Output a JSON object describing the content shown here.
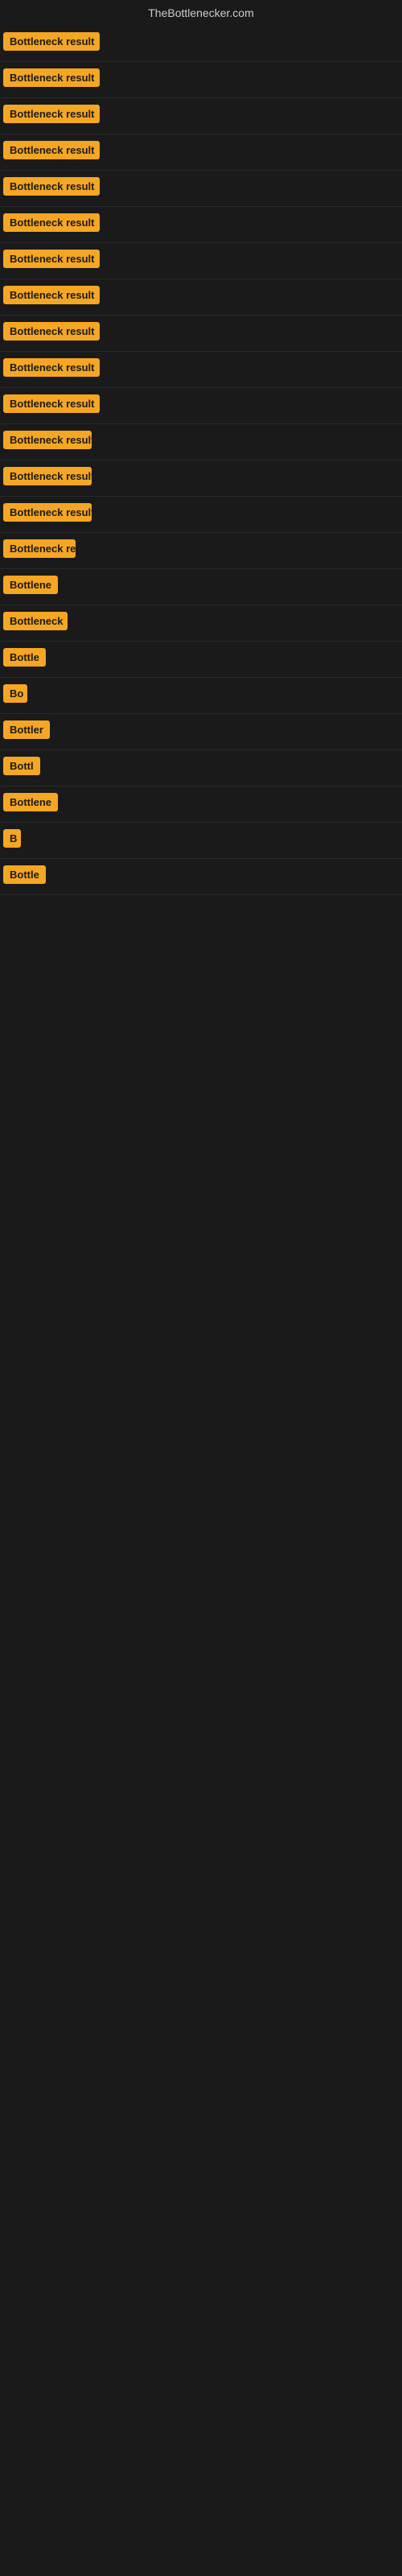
{
  "site": {
    "title": "TheBottlenecker.com"
  },
  "results": [
    {
      "id": 1,
      "label": "Bottleneck result",
      "width": 120
    },
    {
      "id": 2,
      "label": "Bottleneck result",
      "width": 120
    },
    {
      "id": 3,
      "label": "Bottleneck result",
      "width": 120
    },
    {
      "id": 4,
      "label": "Bottleneck result",
      "width": 120
    },
    {
      "id": 5,
      "label": "Bottleneck result",
      "width": 120
    },
    {
      "id": 6,
      "label": "Bottleneck result",
      "width": 120
    },
    {
      "id": 7,
      "label": "Bottleneck result",
      "width": 120
    },
    {
      "id": 8,
      "label": "Bottleneck result",
      "width": 120
    },
    {
      "id": 9,
      "label": "Bottleneck result",
      "width": 120
    },
    {
      "id": 10,
      "label": "Bottleneck result",
      "width": 120
    },
    {
      "id": 11,
      "label": "Bottleneck result",
      "width": 120
    },
    {
      "id": 12,
      "label": "Bottleneck result",
      "width": 110
    },
    {
      "id": 13,
      "label": "Bottleneck result",
      "width": 110
    },
    {
      "id": 14,
      "label": "Bottleneck result",
      "width": 110
    },
    {
      "id": 15,
      "label": "Bottleneck re",
      "width": 90
    },
    {
      "id": 16,
      "label": "Bottlene",
      "width": 72
    },
    {
      "id": 17,
      "label": "Bottleneck",
      "width": 80
    },
    {
      "id": 18,
      "label": "Bottle",
      "width": 58
    },
    {
      "id": 19,
      "label": "Bo",
      "width": 30
    },
    {
      "id": 20,
      "label": "Bottler",
      "width": 60
    },
    {
      "id": 21,
      "label": "Bottl",
      "width": 50
    },
    {
      "id": 22,
      "label": "Bottlene",
      "width": 70
    },
    {
      "id": 23,
      "label": "B",
      "width": 22
    },
    {
      "id": 24,
      "label": "Bottle",
      "width": 55
    }
  ]
}
